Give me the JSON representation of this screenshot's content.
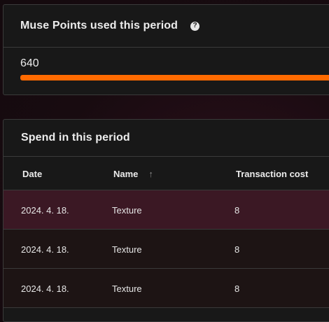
{
  "points_panel": {
    "title": "Muse Points used this period",
    "help_icon": "question-circle-icon",
    "value": "640",
    "progress_fraction": 1.0,
    "progress_color": "#ff6a00"
  },
  "spend_panel": {
    "title": "Spend in this period",
    "columns": {
      "date": "Date",
      "name": "Name",
      "cost": "Transaction cost"
    },
    "sort_icon": "arrow-up-icon",
    "rows": [
      {
        "date": "2024. 4. 18.",
        "name": "Texture",
        "cost": "8"
      },
      {
        "date": "2024. 4. 18.",
        "name": "Texture",
        "cost": "8"
      },
      {
        "date": "2024. 4. 18.",
        "name": "Texture",
        "cost": "8"
      }
    ]
  }
}
